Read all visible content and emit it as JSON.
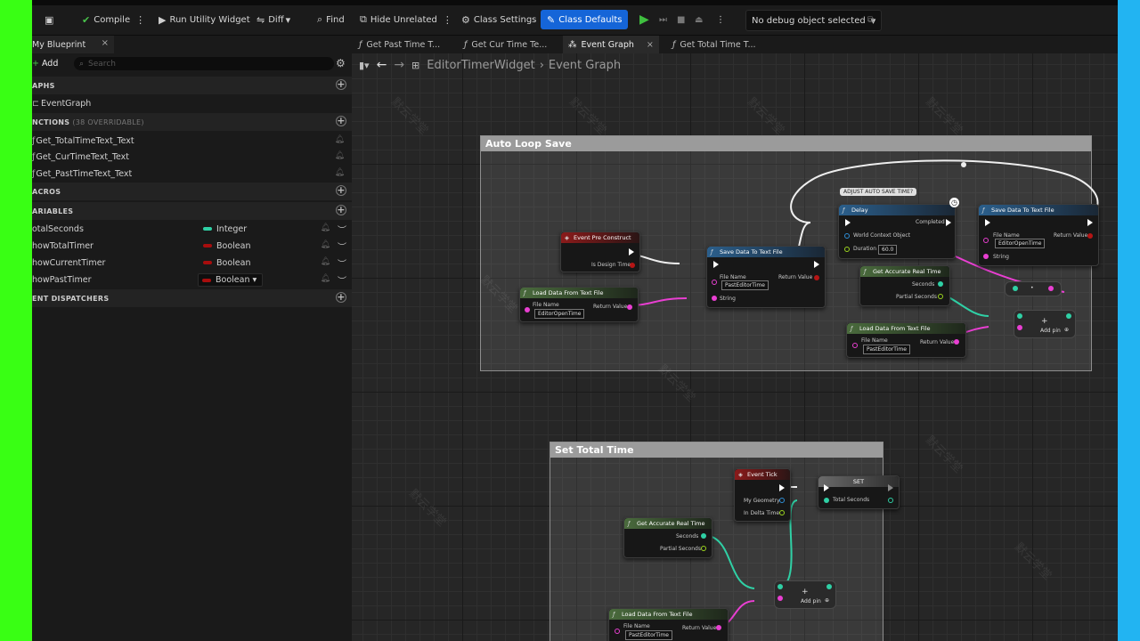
{
  "toolbar": {
    "compile": "Compile",
    "run_utility": "Run Utility Widget",
    "diff": "Diff",
    "find": "Find",
    "hide_unrelated": "Hide Unrelated",
    "class_settings": "Class Settings",
    "class_defaults": "Class Defaults",
    "debug_object": "No debug object selected"
  },
  "panel": {
    "tab": "My Blueprint",
    "add": "Add",
    "search_placeholder": "Search",
    "sections": {
      "graphs": "APHS",
      "functions": "NCTIONS",
      "functions_count": "(38 OVERRIDABLE)",
      "macros": "ACROS",
      "variables": "ARIABLES",
      "dispatchers": "ENT DISPATCHERS"
    },
    "graphs": [
      "EventGraph"
    ],
    "functions": [
      "Get_TotalTimeText_Text",
      "Get_CurTimeText_Text",
      "Get_PastTimeText_Text"
    ],
    "variables": [
      {
        "name": "otalSeconds",
        "type": "Integer",
        "color": "#2fd0a5"
      },
      {
        "name": "howTotalTimer",
        "type": "Boolean",
        "color": "#a80d0d"
      },
      {
        "name": "howCurrentTimer",
        "type": "Boolean",
        "color": "#a80d0d"
      },
      {
        "name": "howPastTimer",
        "type": "Boolean",
        "color": "#a80d0d"
      }
    ]
  },
  "graph_tabs": [
    {
      "label": "Get Past Time T..."
    },
    {
      "label": "Get Cur Time Te..."
    },
    {
      "label": "Event Graph"
    },
    {
      "label": "Get Total Time T..."
    }
  ],
  "breadcrumb": {
    "widget": "EditorTimerWidget",
    "graph": "Event Graph"
  },
  "comments": {
    "auto_loop": "Auto Loop Save",
    "set_total": "Set Total Time"
  },
  "nodes": {
    "pre_construct": {
      "title": "Event Pre Construct",
      "pin": "Is Design Time"
    },
    "load1": {
      "title": "Load Data From Text File",
      "file_name": "File Name",
      "file_value": "EditorOpenTime",
      "ret": "Return Value"
    },
    "save1": {
      "title": "Save Data To Text File",
      "file_name": "File Name",
      "file_value": "PastEditorTime",
      "string": "String",
      "ret": "Return Value"
    },
    "delay": {
      "title": "Delay",
      "completed": "Completed",
      "ctx": "World Context Object",
      "duration": "Duration",
      "duration_value": "60.0"
    },
    "bubble": {
      "text": "ADJUST AUTO SAVE TIME?"
    },
    "save2": {
      "title": "Save Data To Text File",
      "file_name": "File Name",
      "file_value": "EditorOpenTime",
      "string": "String",
      "ret": "Return Value"
    },
    "accurate1": {
      "title": "Get Accurate Real Time",
      "seconds": "Seconds",
      "partial": "Partial Seconds"
    },
    "load2": {
      "title": "Load Data From Text File",
      "file_name": "File Name",
      "file_value": "PastEditorTime",
      "ret": "Return Value"
    },
    "add1": {
      "label": "Add pin",
      "plus": "+"
    },
    "tostr": {
      "label": "•"
    },
    "tick": {
      "title": "Event Tick",
      "geom": "My Geometry",
      "delta": "In Delta Time"
    },
    "set": {
      "title": "SET",
      "pin": "Total Seconds"
    },
    "accurate2": {
      "title": "Get Accurate Real Time",
      "seconds": "Seconds",
      "partial": "Partial Seconds"
    },
    "add2": {
      "label": "Add pin",
      "plus": "+"
    },
    "load3": {
      "title": "Load Data From Text File",
      "file_name": "File Name",
      "file_value": "PastEditorTime",
      "ret": "Return Value"
    }
  },
  "watermark": "默云学堂"
}
